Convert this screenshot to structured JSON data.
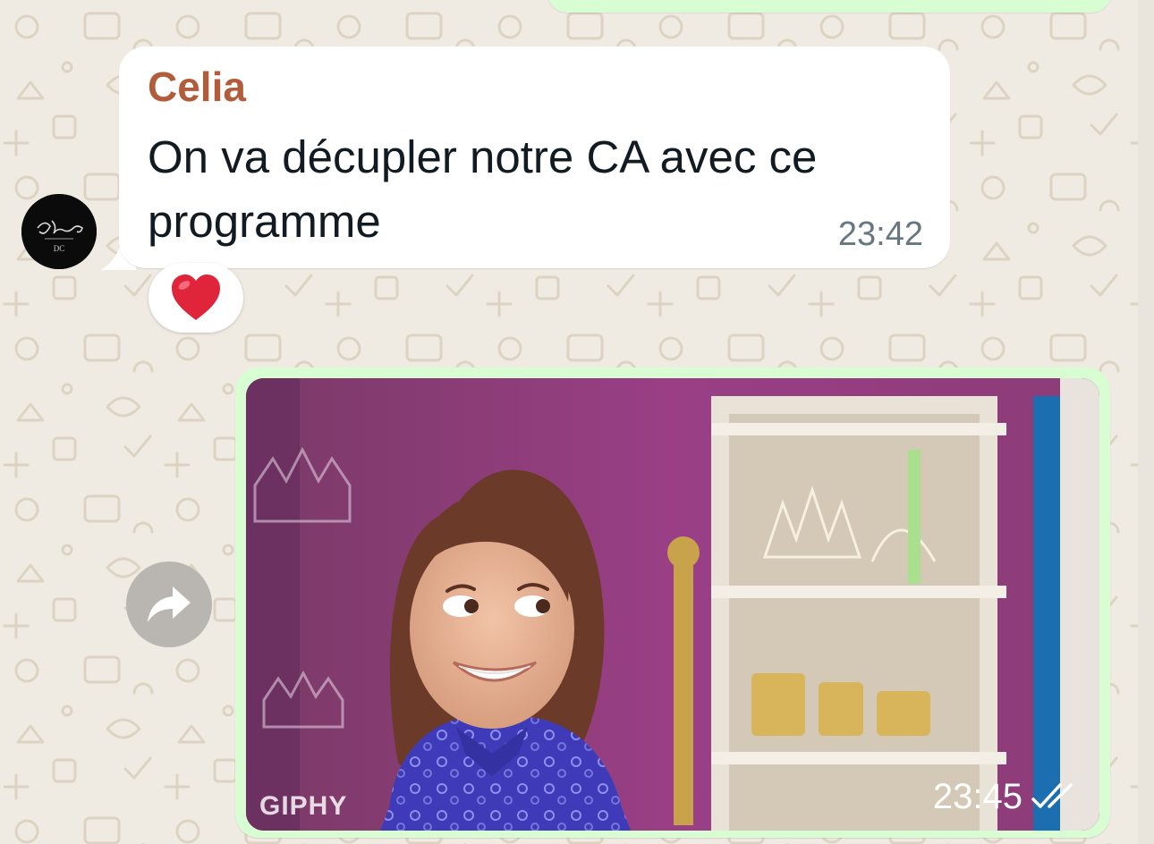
{
  "colors": {
    "chat_background": "#efeae2",
    "incoming_bubble": "#ffffff",
    "outgoing_bubble": "#d9fdd3",
    "sender_name": "#b35c3b",
    "timestamp": "#667781"
  },
  "chat": {
    "incoming_message": {
      "sender": "Celia",
      "text": "On va décupler notre CA avec ce programme",
      "time": "23:42",
      "avatar_icon": "contact-avatar-logo",
      "reaction_emoji": "❤️"
    },
    "outgoing_gif": {
      "watermark": "GIPHY",
      "time": "23:45",
      "status_icon": "double-check-icon",
      "forward_icon": "forward-arrow-icon"
    }
  }
}
